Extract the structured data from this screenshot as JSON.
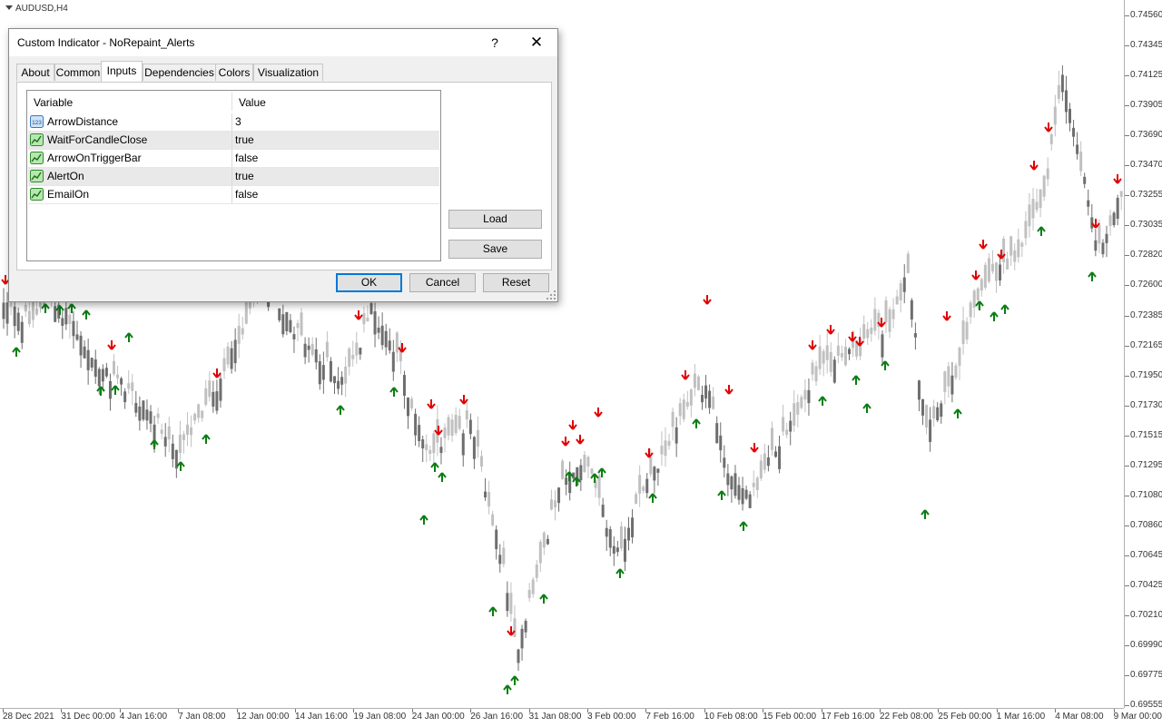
{
  "chart": {
    "symbol_label": "AUDUSD,H4",
    "price_levels": [
      "0.74560",
      "0.74345",
      "0.74125",
      "0.73905",
      "0.73690",
      "0.73470",
      "0.73255",
      "0.73035",
      "0.72820",
      "0.72600",
      "0.72385",
      "0.72165",
      "0.71950",
      "0.71730",
      "0.71515",
      "0.71295",
      "0.71080",
      "0.70860",
      "0.70645",
      "0.70425",
      "0.70210",
      "0.69990",
      "0.69775",
      "0.69555"
    ],
    "time_labels": [
      "28 Dec 2021",
      "31 Dec 00:00",
      "4 Jan 16:00",
      "7 Jan 08:00",
      "12 Jan 00:00",
      "14 Jan 16:00",
      "19 Jan 08:00",
      "24 Jan 00:00",
      "26 Jan 16:00",
      "31 Jan 08:00",
      "3 Feb 00:00",
      "7 Feb 16:00",
      "10 Feb 08:00",
      "15 Feb 00:00",
      "17 Feb 16:00",
      "22 Feb 08:00",
      "25 Feb 00:00",
      "1 Mar 16:00",
      "4 Mar 08:00",
      "9 Mar 00:00"
    ],
    "colors": {
      "bull_candle": "#c0c0c0",
      "bear_candle": "#6e6e6e",
      "up_arrow": "#0a7d12",
      "down_arrow": "#e00000"
    },
    "icons": {
      "up_signal": "arrow-up-icon",
      "down_signal": "arrow-down-icon"
    }
  },
  "dialog": {
    "title": "Custom Indicator - NoRepaint_Alerts",
    "help_label": "?",
    "close_label": "✕",
    "tabs": [
      "About",
      "Common",
      "Inputs",
      "Dependencies",
      "Colors",
      "Visualization"
    ],
    "active_tab": "Inputs",
    "table": {
      "headers": {
        "variable": "Variable",
        "value": "Value"
      },
      "rows": [
        {
          "icon": "integer-123-icon",
          "variable": "ArrowDistance",
          "value": "3"
        },
        {
          "icon": "bool-chart-icon",
          "variable": "WaitForCandleClose",
          "value": "true"
        },
        {
          "icon": "bool-chart-icon",
          "variable": "ArrowOnTriggerBar",
          "value": "false"
        },
        {
          "icon": "bool-chart-icon",
          "variable": "AlertOn",
          "value": "true"
        },
        {
          "icon": "bool-chart-icon",
          "variable": "EmailOn",
          "value": "false"
        }
      ]
    },
    "buttons": {
      "load": "Load",
      "save": "Save",
      "ok": "OK",
      "cancel": "Cancel",
      "reset": "Reset"
    }
  }
}
